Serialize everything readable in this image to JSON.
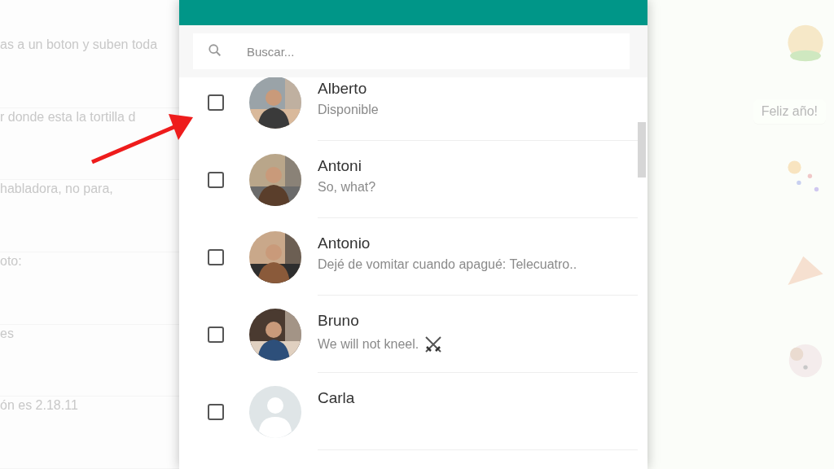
{
  "background_chat": {
    "left_messages": [
      "as a un boton y suben toda",
      "r donde esta la tortilla d",
      "habladora, no para,",
      "oto:",
      "es",
      "ón es 2.18.11"
    ],
    "right_messages": [
      "Feliz año!"
    ]
  },
  "dialog": {
    "search": {
      "placeholder": "Buscar..."
    },
    "contacts": [
      {
        "name": "Alberto",
        "status": "Disponible",
        "status_emoji": false,
        "checked": false
      },
      {
        "name": "Antoni",
        "status": "So, what?",
        "status_emoji": false,
        "checked": false
      },
      {
        "name": "Antonio",
        "status": "Dejé de vomitar cuando apagué: Telecuatro..",
        "status_emoji": false,
        "checked": false
      },
      {
        "name": "Bruno",
        "status": "We will not kneel.",
        "status_emoji": true,
        "checked": false
      },
      {
        "kind": "default",
        "name": "Carla",
        "status_emoji": false,
        "checked": false
      }
    ]
  }
}
